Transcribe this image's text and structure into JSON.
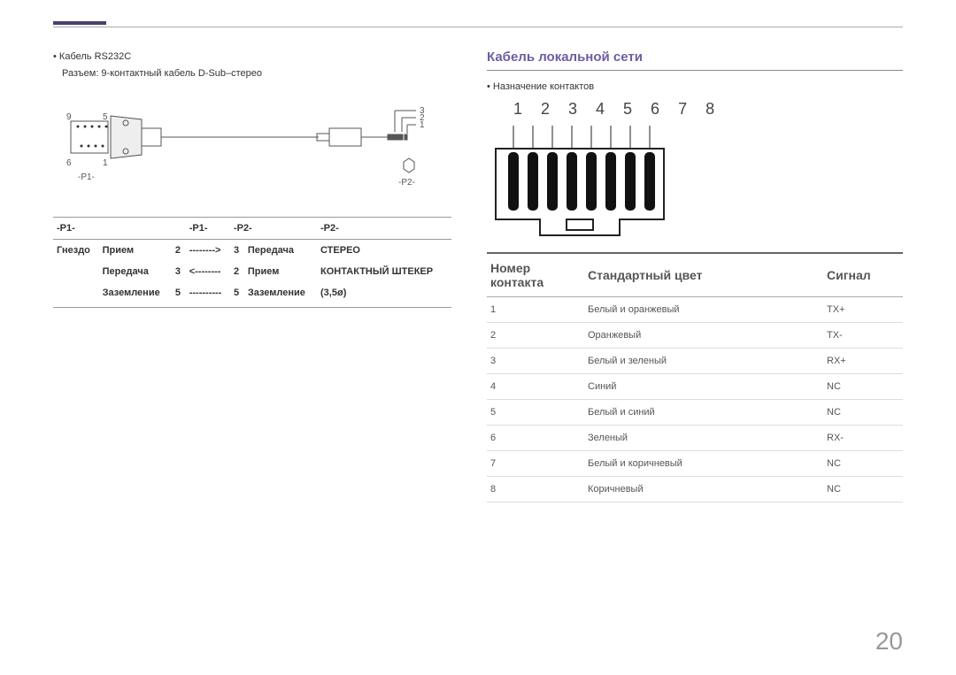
{
  "left": {
    "cable_title": "Кабель RS232C",
    "connector_desc": "Разъем: 9-контактный кабель D-Sub–стерео",
    "fig": {
      "p1": "-P1-",
      "p2": "-P2-",
      "labels": {
        "n9": "9",
        "n5": "5",
        "n6": "6",
        "n1": "1",
        "j3": "3",
        "j2": "2",
        "j1": "1"
      }
    },
    "table_head": {
      "c1": "-P1-",
      "c2": "-P1-",
      "c3": "-P2-",
      "c4": "-P2-"
    },
    "rows": [
      {
        "c0": "Гнездо",
        "c1a": "Прием",
        "c1b": "2",
        "c2": "-------->",
        "c3a": "3",
        "c3b": "Передача",
        "c4": "СТЕРЕО"
      },
      {
        "c0": "",
        "c1a": "Передача",
        "c1b": "3",
        "c2": "<--------",
        "c3a": "2",
        "c3b": "Прием",
        "c4": "КОНТАКТНЫЙ ШТЕКЕР"
      },
      {
        "c0": "",
        "c1a": "Заземление",
        "c1b": "5",
        "c2": "----------",
        "c3a": "5",
        "c3b": "Заземление",
        "c4": "(3,5ø)"
      }
    ]
  },
  "right": {
    "heading": "Кабель локальной сети",
    "pin_assign": "Назначение контактов",
    "nums": "1 2 3 4 5 6 7 8",
    "thead": {
      "num": "Номер контакта",
      "color": "Стандартный цвет",
      "sig": "Сигнал"
    },
    "rows": [
      {
        "n": "1",
        "c": "Белый и оранжевый",
        "s": "TX+"
      },
      {
        "n": "2",
        "c": "Оранжевый",
        "s": "TX-"
      },
      {
        "n": "3",
        "c": "Белый и зеленый",
        "s": "RX+"
      },
      {
        "n": "4",
        "c": "Синий",
        "s": "NC"
      },
      {
        "n": "5",
        "c": "Белый и синий",
        "s": "NC"
      },
      {
        "n": "6",
        "c": "Зеленый",
        "s": "RX-"
      },
      {
        "n": "7",
        "c": "Белый и коричневый",
        "s": "NC"
      },
      {
        "n": "8",
        "c": "Коричневый",
        "s": "NC"
      }
    ]
  },
  "page_number": "20"
}
